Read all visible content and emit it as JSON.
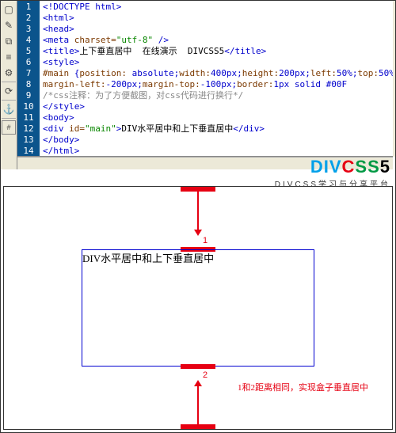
{
  "toolbar": {
    "icons": [
      "file",
      "edit",
      "select",
      "tree",
      "wrench",
      "sep",
      "refresh",
      "sep",
      "anchor",
      "sep",
      "css"
    ]
  },
  "code": {
    "lines": [
      {
        "n": 1,
        "h": "<span class='blue'>&lt;!DOCTYPE html&gt;</span>"
      },
      {
        "n": 2,
        "h": "<span class='blue'>&lt;html&gt;</span>"
      },
      {
        "n": 3,
        "h": "<span class='blue'>&lt;head&gt;</span>"
      },
      {
        "n": 4,
        "h": "<span class='blue'>&lt;meta </span><span class='brown'>charset=</span><span class='green'>\"utf-8\"</span><span class='blue'> /&gt;</span>"
      },
      {
        "n": 5,
        "h": "<span class='blue'>&lt;title&gt;</span><span class='text'>上下垂直居中  在线演示  DIVCSS5</span><span class='blue'>&lt;/title&gt;</span>"
      },
      {
        "n": 6,
        "h": "<span class='blue'>&lt;style&gt;</span>"
      },
      {
        "n": 7,
        "h": "<span class='brown'>#main </span><span class='blue'>{</span><span class='brown'>position:</span><span class='blue'> absolute;</span><span class='brown'>width:</span><span class='blue'>400px;</span><span class='brown'>height:</span><span class='blue'>200px;</span><span class='brown'>left:</span><span class='blue'>50%;</span><span class='brown'>top:</span><span class='blue'>50%;</span>"
      },
      {
        "n": 8,
        "h": "<span class='brown'>margin-left:</span><span class='blue'>-200px;</span><span class='brown'>margin-top:</span><span class='blue'>-100px;</span><span class='brown'>border:</span><span class='blue'>1px solid #00F</span>"
      },
      {
        "n": 9,
        "h": "<span class='gray'>/*css注释：为了方便截图，对css代码进行换行*/</span>"
      },
      {
        "n": 10,
        "h": "<span class='blue'>&lt;/style&gt;</span>"
      },
      {
        "n": 11,
        "h": "<span class='blue'>&lt;body&gt;</span>"
      },
      {
        "n": 12,
        "h": "<span class='blue'>&lt;div </span><span class='brown'>id=</span><span class='green'>\"main\"</span><span class='blue'>&gt;</span><span class='text'>DIV水平居中和上下垂直居中</span><span class='blue'>&lt;/div&gt;</span>"
      },
      {
        "n": 13,
        "h": "<span class='blue'>&lt;/body&gt;</span>"
      },
      {
        "n": 14,
        "h": "<span class='blue'>&lt;/html&gt;</span>"
      }
    ]
  },
  "logo": {
    "d": "DIV",
    "c": "C",
    "s": "SS",
    "n": "5",
    "sub": "DIVCSS学习与分享平台"
  },
  "preview": {
    "box_text": "DIV水平居中和上下垂直居中",
    "n1": "1",
    "n2": "2",
    "note": "1和2距离相同，实现盒子垂直居中"
  }
}
